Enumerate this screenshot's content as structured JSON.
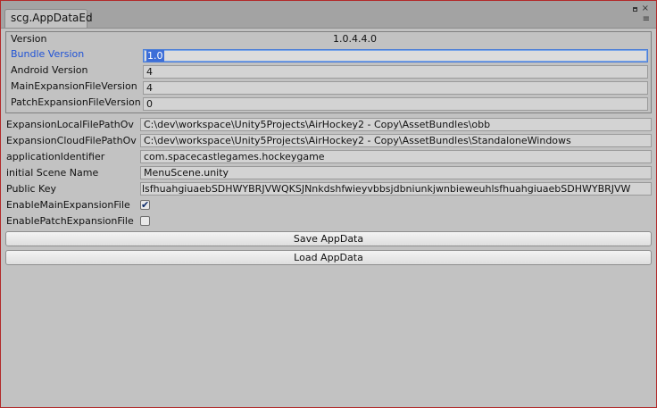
{
  "window": {
    "tab_title": "scg.AppDataEd",
    "maximize_icon": "maximize-icon",
    "close_icon": "close-icon",
    "close_glyph": "×",
    "menu_icon": "menu-icon",
    "menu_glyph": "≡"
  },
  "version_group": {
    "version_label": "Version",
    "version_value": "1.0.4.4.0",
    "bundle_label": "Bundle Version",
    "bundle_value": "1.0",
    "android_label": "Android Version",
    "android_value": "4",
    "main_exp_label": "MainExpansionFileVersion",
    "main_exp_value": "4",
    "patch_exp_label": "PatchExpansionFileVersion",
    "patch_exp_value": "0"
  },
  "fields": {
    "local_path_label": "ExpansionLocalFilePathOv",
    "local_path_value": "C:\\dev\\workspace\\Unity5Projects\\AirHockey2 - Copy\\AssetBundles\\obb",
    "cloud_path_label": "ExpansionCloudFilePathOv",
    "cloud_path_value": "C:\\dev\\workspace\\Unity5Projects\\AirHockey2 - Copy\\AssetBundles\\StandaloneWindows",
    "app_id_label": "applicationIdentifier",
    "app_id_value": "com.spacecastlegames.hockeygame",
    "scene_label": "initial Scene Name",
    "scene_value": "MenuScene.unity",
    "public_key_label": "Public Key",
    "public_key_value": "lsfhuahgiuaebSDHWYBRJVWQKSJNnkdshfwieyvbbsjdbniunkjwnbieweuhlsfhuahgiuaebSDHWYBRJVW",
    "enable_main_label": "EnableMainExpansionFile",
    "enable_main_checked": true,
    "enable_patch_label": "EnablePatchExpansionFile",
    "enable_patch_checked": false
  },
  "buttons": {
    "save_label": "Save AppData",
    "load_label": "Load AppData"
  }
}
